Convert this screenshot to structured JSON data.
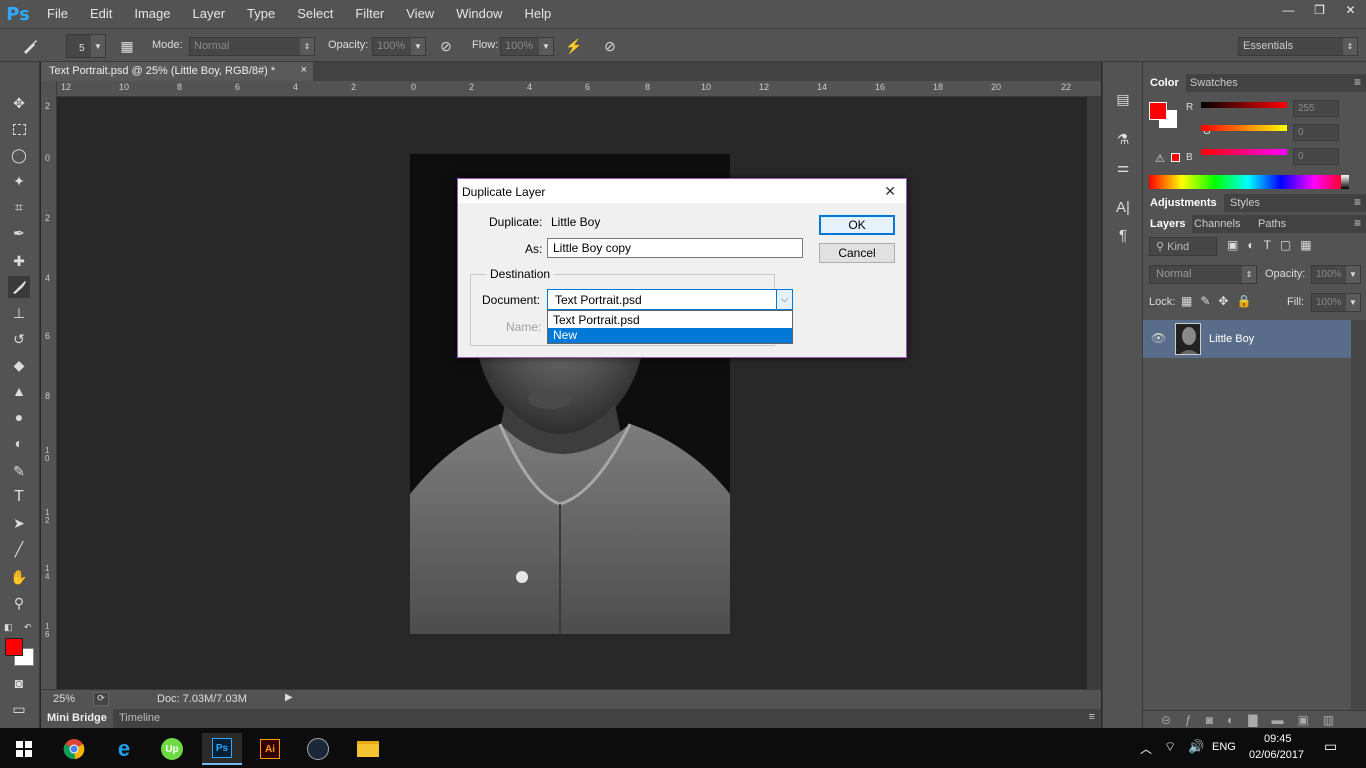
{
  "app": {
    "logo": "Ps"
  },
  "menu": [
    "File",
    "Edit",
    "Image",
    "Layer",
    "Type",
    "Select",
    "Filter",
    "View",
    "Window",
    "Help"
  ],
  "window_controls": {
    "minimize": "—",
    "restore": "❐",
    "close": "✕"
  },
  "options": {
    "brush_size": "5",
    "mode_label": "Mode:",
    "mode_value": "Normal",
    "opacity_label": "Opacity:",
    "opacity_value": "100%",
    "flow_label": "Flow:",
    "flow_value": "100%",
    "workspace": "Essentials"
  },
  "document": {
    "tab_title": "Text Portrait.psd @ 25% (Little Boy, RGB/8#) *",
    "close": "×",
    "zoom": "25%",
    "doc_info": "Doc: 7.03M/7.03M"
  },
  "ruler_h": [
    "12",
    "10",
    "8",
    "6",
    "4",
    "2",
    "0",
    "2",
    "4",
    "6",
    "8",
    "10",
    "12",
    "14",
    "16",
    "18",
    "20",
    "22"
  ],
  "ruler_v": [
    "2",
    "0",
    "2",
    "4",
    "6",
    "8",
    "1 0",
    "1 2",
    "1 4",
    "1 6"
  ],
  "bottom_tabs": [
    "Mini Bridge",
    "Timeline"
  ],
  "panels": {
    "color_tabs": [
      "Color",
      "Swatches"
    ],
    "color": {
      "fg": "#ff0000",
      "bg": "#ffffff",
      "r_label": "R",
      "g_label": "G",
      "b_label": "B",
      "r": "255",
      "g": "0",
      "b": "0"
    },
    "adjust_tabs": [
      "Adjustments",
      "Styles"
    ],
    "layer_tabs": [
      "Layers",
      "Channels",
      "Paths"
    ],
    "kind": "Kind",
    "blend": "Normal",
    "opacity_label": "Opacity:",
    "opacity": "100%",
    "lock_label": "Lock:",
    "fill_label": "Fill:",
    "fill": "100%",
    "layer_name": "Little Boy"
  },
  "dialog": {
    "title": "Duplicate Layer",
    "duplicate_label": "Duplicate:",
    "duplicate_value": "Little Boy",
    "as_label": "As:",
    "as_value": "Little Boy copy",
    "destination_label": "Destination",
    "document_label": "Document:",
    "document_value": "Text Portrait.psd",
    "name_label": "Name:",
    "options": [
      "Text Portrait.psd",
      "New"
    ],
    "ok": "OK",
    "cancel": "Cancel",
    "close": "✕"
  },
  "taskbar": {
    "lang": "ENG",
    "time": "09:45",
    "date": "02/06/2017",
    "apps": [
      "Ps",
      "Ai"
    ]
  }
}
